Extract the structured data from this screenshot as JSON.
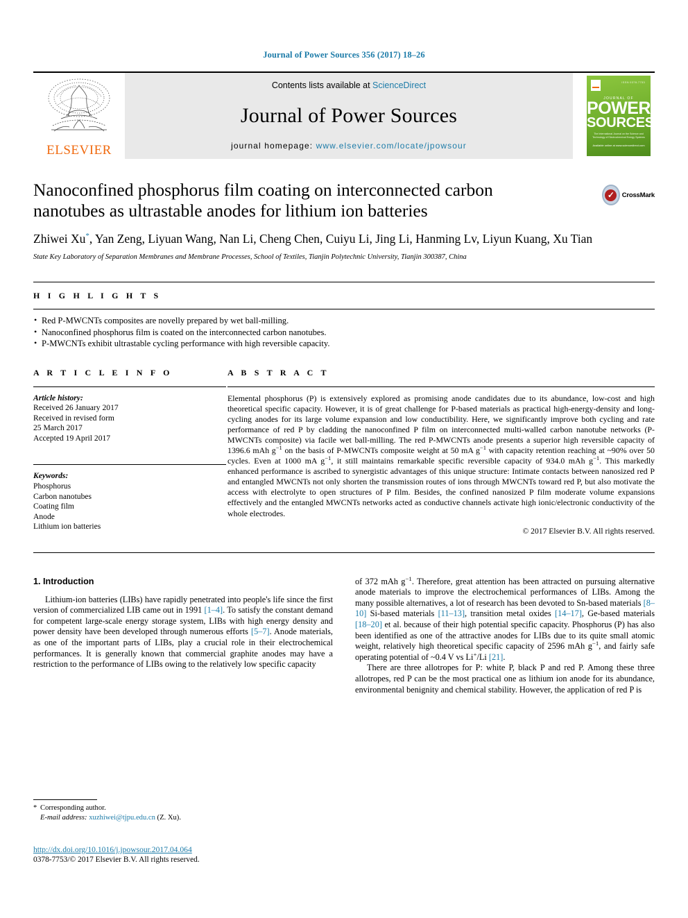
{
  "running_head": "Journal of Power Sources 356 (2017) 18–26",
  "masthead": {
    "contents_prefix": "Contents lists available at ",
    "sciencedirect": "ScienceDirect",
    "journal_title": "Journal of Power Sources",
    "homepage_prefix": "journal homepage: ",
    "homepage_url": "www.elsevier.com/locate/jpowsour",
    "publisher_wordmark": "ELSEVIER",
    "cover": {
      "top_note": "ISSN 0378-7753",
      "journal_of": "JOURNAL OF",
      "power": "POWER",
      "sources": "SOURCES",
      "subtitle": "The International Journal on the Science and Technology of Electrochemical Energy Systems",
      "bottom_note": "Available online at\nwww.sciencedirect.com"
    },
    "accent_orange": "#f06a0f",
    "cover_green": "#6fae2c",
    "link_blue": "#1c7ba8"
  },
  "article": {
    "title": "Nanoconfined phosphorus film coating on interconnected carbon nanotubes as ultrastable anodes for lithium ion batteries",
    "authors": "Zhiwei Xu*, Yan Zeng, Liyuan Wang, Nan Li, Cheng Chen, Cuiyu Li, Jing Li, Hanming Lv, Liyun Kuang, Xu Tian",
    "affiliation": "State Key Laboratory of Separation Membranes and Membrane Processes, School of Textiles, Tianjin Polytechnic University, Tianjin 300387, China",
    "crossmark_label": "CrossMark"
  },
  "highlights": {
    "heading": "H I G H L I G H T S",
    "items": [
      "Red P-MWCNTs composites are novelly prepared by wet ball-milling.",
      "Nanoconfined phosphorus film is coated on the interconnected carbon nanotubes.",
      "P-MWCNTs exhibit ultrastable cycling performance with high reversible capacity."
    ]
  },
  "article_info": {
    "heading": "A R T I C L E   I N F O",
    "history_label": "Article history:",
    "history": [
      "Received 26 January 2017",
      "Received in revised form",
      "25 March 2017",
      "Accepted 19 April 2017"
    ],
    "keywords_label": "Keywords:",
    "keywords": [
      "Phosphorus",
      "Carbon nanotubes",
      "Coating film",
      "Anode",
      "Lithium ion batteries"
    ]
  },
  "abstract": {
    "heading": "A B S T R A C T",
    "text": "Elemental phosphorus (P) is extensively explored as promising anode candidates due to its abundance, low-cost and high theoretical specific capacity. However, it is of great challenge for P-based materials as practical high-energy-density and long-cycling anodes for its large volume expansion and low conductibility. Here, we significantly improve both cycling and rate performance of red P by cladding the nanoconfined P film on interconnected multi-walled carbon nanotube networks (P-MWCNTs composite) via facile wet ball-milling. The red P-MWCNTs anode presents a superior high reversible capacity of 1396.6 mAh g−1 on the basis of P-MWCNTs composite weight at 50 mA g−1 with capacity retention reaching at ~90% over 50 cycles. Even at 1000 mA g−1, it still maintains remarkable specific reversible capacity of 934.0 mAh g−1. This markedly enhanced performance is ascribed to synergistic advantages of this unique structure: Intimate contacts between nanosized red P and entangled MWCNTs not only shorten the transmission routes of ions through MWCNTs toward red P, but also motivate the access with electrolyte to open structures of P film. Besides, the confined nanosized P film moderate volume expansions effectively and the entangled MWCNTs networks acted as conductive channels activate high ionic/electronic conductivity of the whole electrodes.",
    "copyright": "© 2017 Elsevier B.V. All rights reserved."
  },
  "introduction": {
    "heading": "1.  Introduction",
    "paragraph_1_a": "Lithium-ion batteries (LIBs) have rapidly penetrated into people's life since the first version of commercialized LIB came out in 1991 ",
    "cite_1_4": "[1–4]",
    "paragraph_1_b": ". To satisfy the constant demand for competent large-scale energy storage system, LIBs with high energy density and power density have been developed through numerous efforts ",
    "cite_5_7": "[5–7]",
    "paragraph_1_c": ". Anode materials, as one of the important parts of LIBs, play a crucial role in their electrochemical performances. It is generally known that commercial graphite anodes may have a restriction to the performance of LIBs owing to the relatively low specific capacity",
    "paragraph_2_a": "of 372 mAh g−1. Therefore, great attention has been attracted on pursuing alternative anode materials to improve the electrochemical performances of LIBs. Among the many possible alternatives, a lot of research has been devoted to Sn-based materials ",
    "cite_8_10": "[8–10]",
    "paragraph_2_b": " Si-based materials ",
    "cite_11_13": "[11–13]",
    "paragraph_2_c": ", transition metal oxides ",
    "cite_14_17": "[14–17]",
    "paragraph_2_d": ", Ge-based materials ",
    "cite_18_20": "[18–20]",
    "paragraph_2_e": " et al. because of their high potential specific capacity. Phosphorus (P) has also been identified as one of the attractive anodes for LIBs due to its quite small atomic weight, relatively high theoretical specific capacity of 2596 mAh g−1, and fairly safe operating potential of ~0.4 V vs Li+/Li ",
    "cite_21": "[21]",
    "paragraph_2_f": ".",
    "paragraph_3": "There are three allotropes for P: white P, black P and red P. Among these three allotropes, red P can be the most practical one as lithium ion anode for its abundance, environmental benignity and chemical stability. However, the application of red P is"
  },
  "footnote": {
    "star": "*",
    "corresponding": "Corresponding author.",
    "email_label": "E-mail address: ",
    "email": "xuzhiwei@tjpu.edu.cn",
    "email_suffix": " (Z. Xu)."
  },
  "footer": {
    "doi": "http://dx.doi.org/10.1016/j.jpowsour.2017.04.064",
    "issn": "0378-7753/© 2017 Elsevier B.V. All rights reserved."
  }
}
